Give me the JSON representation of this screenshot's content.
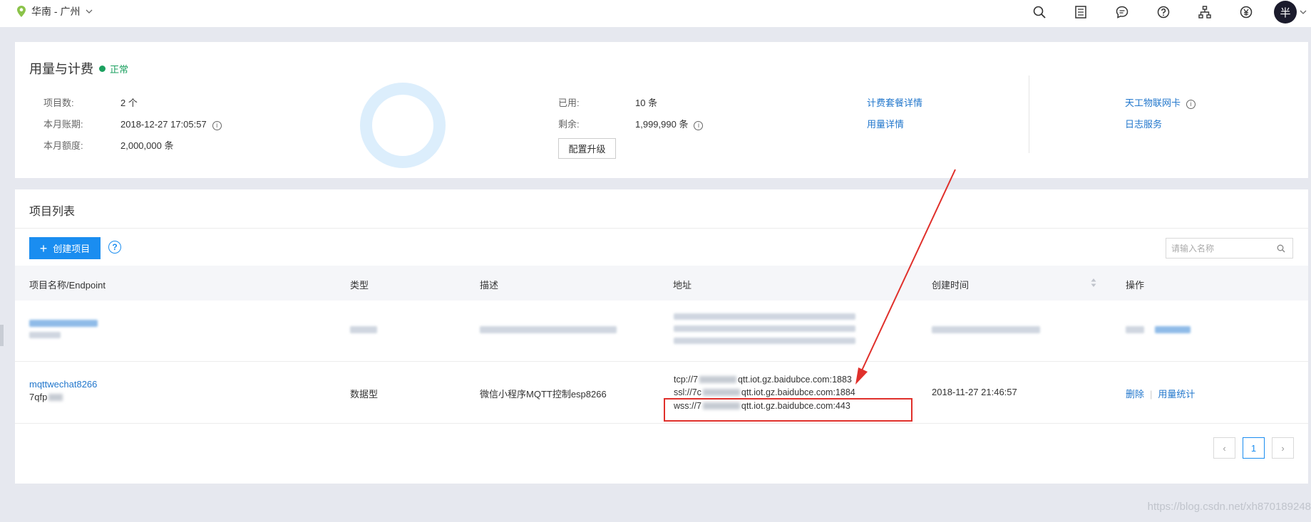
{
  "topbar": {
    "region": "华南 - 广州",
    "icons": [
      "search-icon",
      "document-list-icon",
      "message-icon",
      "help-icon",
      "sitemap-icon",
      "currency-icon"
    ],
    "avatar": "半"
  },
  "usage": {
    "title": "用量与计费",
    "status": "正常",
    "project_count_label": "项目数:",
    "project_count_value": "2 个",
    "billing_period_label": "本月账期:",
    "billing_period_value": "2018-12-27 17:05:57",
    "quota_label": "本月额度:",
    "quota_value": "2,000,000 条",
    "used_label": "已用:",
    "used_value": "10 条",
    "remaining_label": "剩余:",
    "remaining_value": "1,999,990 条",
    "upgrade_button": "配置升级",
    "links": {
      "billing_detail": "计费套餐详情",
      "usage_detail": "用量详情",
      "sim_card": "天工物联网卡",
      "log_service": "日志服务"
    }
  },
  "projects": {
    "title": "项目列表",
    "create_button": "创建项目",
    "search_placeholder": "请输入名称",
    "columns": [
      "项目名称/Endpoint",
      "类型",
      "描述",
      "地址",
      "创建时间",
      "操作"
    ],
    "rows": [
      {
        "name": "mqttwechat8266",
        "endpoint": "7qfp",
        "type": "数据型",
        "description": "微信小程序MQTT控制esp8266",
        "addr_tcp_prefix": "tcp://7",
        "addr_tcp_suffix": "qtt.iot.gz.baidubce.com:1883",
        "addr_ssl_prefix": "ssl://7c",
        "addr_ssl_suffix": "qtt.iot.gz.baidubce.com:1884",
        "addr_wss_prefix": "wss://7",
        "addr_wss_suffix": "qtt.iot.gz.baidubce.com:443",
        "created": "2018-11-27 21:46:57",
        "op_delete": "删除",
        "op_stats": "用量统计"
      }
    ],
    "pagination": {
      "current": "1"
    }
  },
  "watermark": "https://blog.csdn.net/xh870189248",
  "colors": {
    "primary": "#1a8df0",
    "link": "#2277cc",
    "success": "#1ba05f",
    "highlight": "#e0302b"
  }
}
